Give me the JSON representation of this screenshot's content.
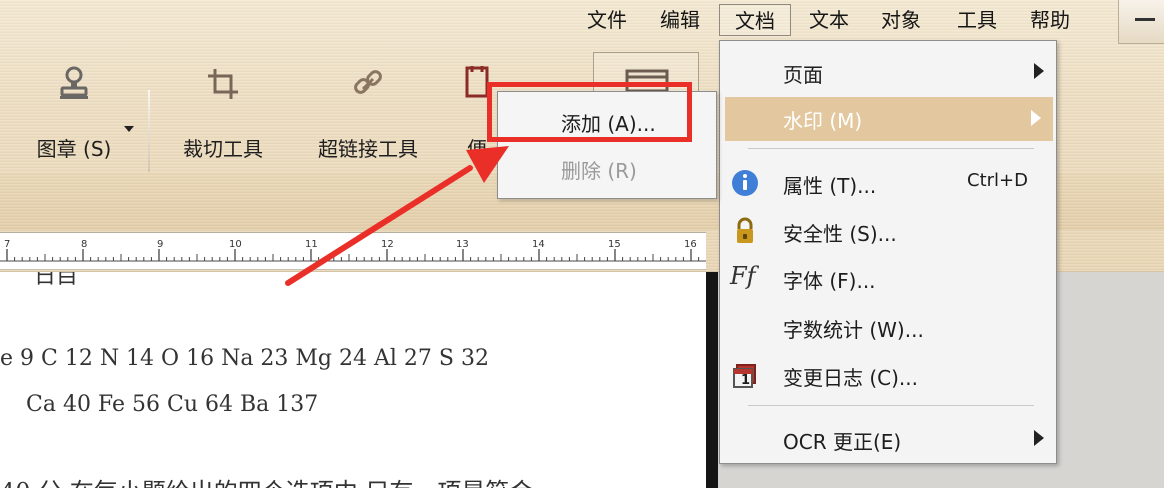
{
  "menu": {
    "file": "文件",
    "edit": "编辑",
    "document": "文档",
    "text": "文本",
    "object": "对象",
    "tools": "工具",
    "help": "帮助"
  },
  "toolbar": {
    "stamp_label": "图章 (S)",
    "crop_label": "裁切工具",
    "hyperlink_label": "超链接工具",
    "partial_label": "便"
  },
  "document": {
    "line_top": "日目",
    "line_one": "e 9   C 12   N 14   O 16   Na 23   Mg 24   Al 27   S 32",
    "line_two": "Ca 40   Fe 56   Cu 64   Ba 137",
    "line_bottom": "40 分    在每小题给出的四个选项中  只有一项是符合"
  },
  "ruler": {
    "ticks": [
      "7",
      "8",
      "9",
      "10",
      "11",
      "12",
      "13",
      "14",
      "15",
      "16"
    ]
  },
  "context_menu": {
    "page": "页面",
    "watermark": "水印 (M)",
    "properties": "属性 (T)...",
    "properties_shortcut": "Ctrl+D",
    "security": "安全性 (S)...",
    "font": "字体 (F)...",
    "word_count": "字数统计 (W)...",
    "change_log": "变更日志 (C)...",
    "ocr_correction": "OCR 更正(E)",
    "font_icon_text": "Ff",
    "change_log_icon_text": "1"
  },
  "watermark_submenu": {
    "add": "添加 (A)...",
    "delete": "删除 (R)"
  },
  "colors": {
    "menu_highlight": "#e3c89f",
    "red_highlight": "#ea2f28",
    "info_blue": "#3f7fd8",
    "lock_gold": "#c9971d"
  }
}
